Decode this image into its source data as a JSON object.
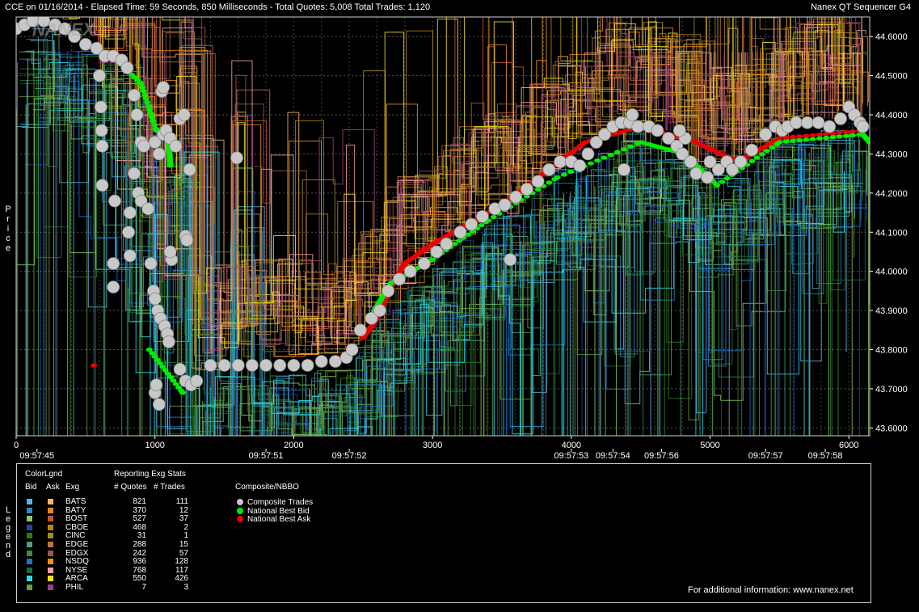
{
  "header": {
    "left": "CCE on 01/16/2014  -  Elapsed Time: 59 Seconds, 850 Milliseconds  -  Total Quotes: 5,008  Total Trades: 1,120",
    "right": "Nanex QT Sequencer G4"
  },
  "axis_titles": {
    "y": "Price",
    "legend": "Legend"
  },
  "watermark": "NANEX",
  "footer": {
    "info": "For additional information: www.nanex.net"
  },
  "legend": {
    "title_colorlgnd": "ColorLgnd",
    "col_bid": "Bid",
    "col_ask": "Ask",
    "col_exg": "Exg",
    "stats_title": "Reporting Exg Stats",
    "col_quotes": "# Quotes",
    "col_trades": "# Trades",
    "composite_title": "Composite/NBBO",
    "composite_items": [
      {
        "label": "Composite Trades",
        "color": "#c8c8c8"
      },
      {
        "label": "National Best Bid",
        "color": "#00ee00"
      },
      {
        "label": "National Best Ask",
        "color": "#ee0000"
      }
    ],
    "exchanges": [
      {
        "name": "BATS",
        "bid": "#5ab4e6",
        "ask": "#f2b860",
        "quotes": "821",
        "trades": "111"
      },
      {
        "name": "BATY",
        "bid": "#2f88cc",
        "ask": "#e0843a",
        "quotes": "370",
        "trades": "12"
      },
      {
        "name": "BOST",
        "bid": "#8ecb62",
        "ask": "#c2563a",
        "quotes": "527",
        "trades": "37"
      },
      {
        "name": "CBOE",
        "bid": "#1f4aa0",
        "ask": "#b8860b",
        "quotes": "468",
        "trades": "2"
      },
      {
        "name": "CINC",
        "bid": "#2c7a1e",
        "ask": "#a09020",
        "quotes": "31",
        "trades": "1"
      },
      {
        "name": "EDGE",
        "bid": "#4aa56c",
        "ask": "#b87050",
        "quotes": "288",
        "trades": "15"
      },
      {
        "name": "EDGX",
        "bid": "#3c8c3c",
        "ask": "#9a5a48",
        "quotes": "242",
        "trades": "57"
      },
      {
        "name": "NSDQ",
        "bid": "#2272c8",
        "ask": "#f0901a",
        "quotes": "936",
        "trades": "128"
      },
      {
        "name": "NYSE",
        "bid": "#1c6a3a",
        "ask": "#f0a0a0",
        "quotes": "768",
        "trades": "117"
      },
      {
        "name": "ARCA",
        "bid": "#22e0f0",
        "ask": "#f0e020",
        "quotes": "550",
        "trades": "426"
      },
      {
        "name": "PHIL",
        "bid": "#6aa040",
        "ask": "#a04080",
        "quotes": "7",
        "trades": "3"
      }
    ]
  },
  "colors": {
    "background": "#000000",
    "grid": "#555555",
    "axis": "#ffffff",
    "trade": "#c8c8c8",
    "bid": "#00ee00",
    "ask": "#ee0000"
  },
  "chart_data": {
    "type": "scatter",
    "title": "",
    "xlabel": "",
    "ylabel": "Price",
    "grid": true,
    "xlim": [
      0,
      6150
    ],
    "ylim": [
      43.58,
      44.65
    ],
    "x_ticks": [
      "0",
      "1000",
      "2000",
      "3000",
      "4000",
      "5000",
      "6000"
    ],
    "x_tick_values": [
      0,
      1000,
      2000,
      3000,
      4000,
      5000,
      6000
    ],
    "y_ticks": [
      "43.6000",
      "43.7000",
      "43.8000",
      "43.9000",
      "44.0000",
      "44.1000",
      "44.2000",
      "44.3000",
      "44.4000",
      "44.5000",
      "44.6000"
    ],
    "y_tick_values": [
      43.6,
      43.7,
      43.8,
      43.9,
      44.0,
      44.1,
      44.2,
      44.3,
      44.4,
      44.5,
      44.6
    ],
    "time_labels": [
      {
        "x": 150,
        "label": "09:57:45"
      },
      {
        "x": 1800,
        "label": "09:57:51"
      },
      {
        "x": 2400,
        "label": "09:57:52"
      },
      {
        "x": 4000,
        "label": "09:57:53"
      },
      {
        "x": 4300,
        "label": "09:57:54"
      },
      {
        "x": 4650,
        "label": "09:57:56"
      },
      {
        "x": 5400,
        "label": "09:57:57"
      },
      {
        "x": 5830,
        "label": "09:57:58"
      }
    ],
    "trades": {
      "name": "Composite Trades",
      "points": [
        [
          0,
          44.62
        ],
        [
          60,
          44.63
        ],
        [
          120,
          44.64
        ],
        [
          200,
          44.64
        ],
        [
          280,
          44.63
        ],
        [
          350,
          44.62
        ],
        [
          420,
          44.6
        ],
        [
          500,
          44.58
        ],
        [
          580,
          44.57
        ],
        [
          640,
          44.55
        ],
        [
          700,
          44.55
        ],
        [
          760,
          44.54
        ],
        [
          800,
          44.52
        ],
        [
          850,
          44.45
        ],
        [
          870,
          44.4
        ],
        [
          900,
          44.33
        ],
        [
          920,
          44.32
        ],
        [
          600,
          44.5
        ],
        [
          610,
          44.42
        ],
        [
          615,
          44.36
        ],
        [
          620,
          44.32
        ],
        [
          620,
          44.22
        ],
        [
          710,
          44.18
        ],
        [
          700,
          44.02
        ],
        [
          700,
          43.96
        ],
        [
          820,
          44.15
        ],
        [
          850,
          44.25
        ],
        [
          880,
          44.2
        ],
        [
          900,
          44.18
        ],
        [
          950,
          44.16
        ],
        [
          810,
          44.1
        ],
        [
          820,
          44.04
        ],
        [
          1000,
          44.33
        ],
        [
          1030,
          44.3
        ],
        [
          1060,
          44.35
        ],
        [
          1080,
          44.36
        ],
        [
          1110,
          44.34
        ],
        [
          1150,
          44.32
        ],
        [
          1180,
          44.39
        ],
        [
          1210,
          44.4
        ],
        [
          1250,
          44.26
        ],
        [
          1220,
          44.09
        ],
        [
          1230,
          44.08
        ],
        [
          1590,
          44.29
        ],
        [
          970,
          44.02
        ],
        [
          990,
          43.95
        ],
        [
          1000,
          43.93
        ],
        [
          1020,
          43.9
        ],
        [
          1040,
          43.88
        ],
        [
          1070,
          43.86
        ],
        [
          1090,
          43.84
        ],
        [
          1120,
          44.03
        ],
        [
          1110,
          44.05
        ],
        [
          1100,
          43.82
        ],
        [
          1180,
          43.75
        ],
        [
          1220,
          43.72
        ],
        [
          1260,
          43.71
        ],
        [
          1300,
          43.72
        ],
        [
          1000,
          43.69
        ],
        [
          1010,
          43.71
        ],
        [
          1030,
          43.66
        ],
        [
          1050,
          44.46
        ],
        [
          1060,
          44.47
        ],
        [
          1400,
          43.76
        ],
        [
          1500,
          43.76
        ],
        [
          1600,
          43.76
        ],
        [
          1700,
          43.76
        ],
        [
          1800,
          43.76
        ],
        [
          1900,
          43.76
        ],
        [
          2000,
          43.76
        ],
        [
          2100,
          43.76
        ],
        [
          2200,
          43.77
        ],
        [
          2300,
          43.77
        ],
        [
          2380,
          43.78
        ],
        [
          2420,
          43.8
        ],
        [
          2480,
          43.85
        ],
        [
          2560,
          43.88
        ],
        [
          2620,
          43.9
        ],
        [
          2680,
          43.95
        ],
        [
          2760,
          43.98
        ],
        [
          2840,
          44.0
        ],
        [
          2940,
          44.02
        ],
        [
          3030,
          44.05
        ],
        [
          3100,
          44.07
        ],
        [
          3200,
          44.1
        ],
        [
          3280,
          44.12
        ],
        [
          3360,
          44.14
        ],
        [
          3450,
          44.16
        ],
        [
          3520,
          44.17
        ],
        [
          3600,
          44.19
        ],
        [
          3680,
          44.21
        ],
        [
          3760,
          44.23
        ],
        [
          3840,
          44.26
        ],
        [
          3920,
          44.28
        ],
        [
          4000,
          44.28
        ],
        [
          4060,
          44.27
        ],
        [
          4120,
          44.3
        ],
        [
          4180,
          44.33
        ],
        [
          4240,
          44.35
        ],
        [
          4300,
          44.37
        ],
        [
          4360,
          44.38
        ],
        [
          4420,
          44.38
        ],
        [
          4480,
          44.37
        ],
        [
          4560,
          44.37
        ],
        [
          4620,
          44.36
        ],
        [
          4700,
          44.34
        ],
        [
          4760,
          44.32
        ],
        [
          4800,
          44.3
        ],
        [
          4820,
          44.34
        ],
        [
          4860,
          44.28
        ],
        [
          4900,
          44.25
        ],
        [
          4980,
          44.24
        ],
        [
          5060,
          44.26
        ],
        [
          5120,
          44.28
        ],
        [
          5160,
          44.26
        ],
        [
          5220,
          44.28
        ],
        [
          5300,
          44.31
        ],
        [
          5400,
          44.35
        ],
        [
          5470,
          44.37
        ],
        [
          5520,
          44.36
        ],
        [
          5560,
          44.37
        ],
        [
          5620,
          44.38
        ],
        [
          5700,
          44.38
        ],
        [
          5780,
          44.38
        ],
        [
          5860,
          44.37
        ],
        [
          5940,
          44.39
        ],
        [
          6000,
          44.42
        ],
        [
          6040,
          44.4
        ],
        [
          6080,
          44.38
        ],
        [
          6100,
          44.37
        ],
        [
          3560,
          44.03
        ],
        [
          4380,
          44.26
        ],
        [
          4440,
          44.4
        ],
        [
          4780,
          44.36
        ],
        [
          5000,
          44.28
        ]
      ]
    },
    "nbbo_bid": {
      "name": "National Best Bid",
      "points": [
        [
          660,
          44.56
        ],
        [
          900,
          44.48
        ],
        [
          1010,
          44.36
        ],
        [
          1030,
          44.36
        ],
        [
          1100,
          44.33
        ],
        [
          1110,
          44.27
        ],
        [
          960,
          43.8
        ],
        [
          1200,
          43.69
        ],
        [
          2580,
          43.9
        ],
        [
          2700,
          43.97
        ],
        [
          3000,
          44.03
        ],
        [
          3400,
          44.13
        ],
        [
          3900,
          44.24
        ],
        [
          4500,
          44.33
        ],
        [
          4820,
          44.3
        ],
        [
          5050,
          44.22
        ],
        [
          5500,
          44.33
        ],
        [
          6100,
          44.35
        ],
        [
          6150,
          44.33
        ]
      ]
    },
    "nbbo_ask": {
      "name": "National Best Ask",
      "points": [
        [
          560,
          43.76
        ],
        [
          1500,
          43.77
        ],
        [
          2500,
          43.83
        ],
        [
          2600,
          43.88
        ],
        [
          2700,
          43.96
        ],
        [
          2800,
          44.02
        ],
        [
          3000,
          44.07
        ],
        [
          3200,
          44.11
        ],
        [
          3500,
          44.17
        ],
        [
          3800,
          44.25
        ],
        [
          4100,
          44.33
        ],
        [
          4500,
          44.37
        ],
        [
          4900,
          44.33
        ],
        [
          5200,
          44.28
        ],
        [
          5500,
          44.34
        ],
        [
          6100,
          44.36
        ]
      ]
    }
  }
}
